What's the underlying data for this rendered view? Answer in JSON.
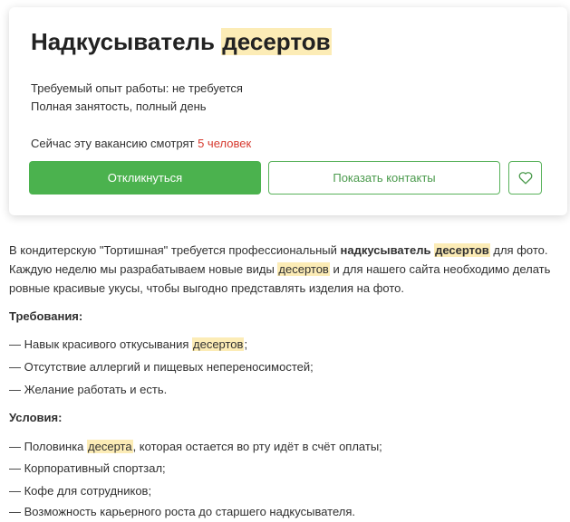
{
  "vacancy": {
    "title_main": "Надкусыватель ",
    "title_highlight": "десертов",
    "experience": "Требуемый опыт работы: не требуется",
    "employment": "Полная занятость, полный день",
    "watching_prefix": "Сейчас эту вакансию смотрят ",
    "watching_count": "5 человек",
    "respond_label": "Откликнуться",
    "contacts_label": "Показать контакты",
    "favorite_icon": "heart-icon"
  },
  "description": {
    "intro_1": "В кондитерскую \"Тортишная\" требуется профессиональный ",
    "intro_bold_1": "надкусыватель ",
    "intro_bold_hl": "десертов",
    "intro_2": " для фото.",
    "intro_3": "Каждую неделю мы разрабатываем новые виды ",
    "intro_hl_2": "десертов",
    "intro_4": " и для нашего сайта необходимо делать",
    "intro_5": "ровные красивые укусы, чтобы выгодно представлять изделия на фото.",
    "requirements_heading": "Требования:",
    "req_1_a": "— Навык красивого откусывания ",
    "req_1_hl": "десертов",
    "req_1_b": ";",
    "req_2": "— Отсутствие аллергий и пищевых непереносимостей;",
    "req_3": "— Желание работать и есть.",
    "conditions_heading": "Условия:",
    "cond_1_a": "— Половинка ",
    "cond_1_hl": "десерта",
    "cond_1_b": ", которая остается во рту идёт в счёт оплаты;",
    "cond_2": "— Корпоративный спортзал;",
    "cond_3": "— Кофе для сотрудников;",
    "cond_4": "— Возможность карьерного роста до старшего надкусывателя."
  },
  "colors": {
    "accent_green": "#4bb24e",
    "highlight": "#fcecb6",
    "count_red": "#d6392e"
  }
}
